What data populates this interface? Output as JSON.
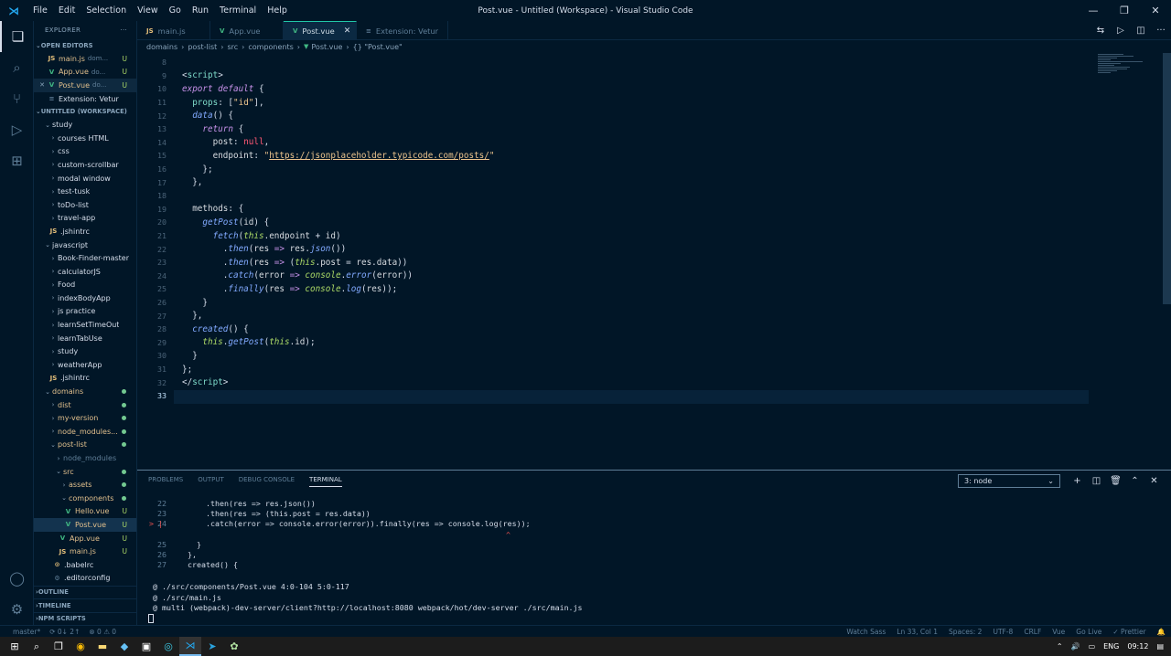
{
  "window": {
    "title": "Post.vue - Untitled (Workspace) - Visual Studio Code",
    "menu": [
      "File",
      "Edit",
      "Selection",
      "View",
      "Go",
      "Run",
      "Terminal",
      "Help"
    ]
  },
  "sidebar": {
    "header": "EXPLORER",
    "open_editors_label": "OPEN EDITORS",
    "open_editors": [
      {
        "icon": "JS",
        "name": "main.js",
        "desc": "dom...",
        "status": "U"
      },
      {
        "icon": "V",
        "name": "App.vue",
        "desc": "do...",
        "status": "U"
      },
      {
        "icon": "V",
        "name": "Post.vue",
        "desc": "do...",
        "status": "U"
      },
      {
        "icon": "≡",
        "name": "Extension: Vetur",
        "desc": "",
        "status": ""
      }
    ],
    "workspace_label": "UNTITLED (WORKSPACE)",
    "tree": [
      {
        "name": "study",
        "depth": 0
      },
      {
        "name": "courses HTML",
        "depth": 1
      },
      {
        "name": "css",
        "depth": 1
      },
      {
        "name": "custom-scrollbar",
        "depth": 1
      },
      {
        "name": "modal window",
        "depth": 1
      },
      {
        "name": "test-tusk",
        "depth": 1
      },
      {
        "name": "toDo-list",
        "depth": 1
      },
      {
        "name": "travel-app",
        "depth": 1
      },
      {
        "name": ".jshintrc",
        "depth": 1
      },
      {
        "name": "javascript",
        "depth": 0
      },
      {
        "name": "Book-Finder-master",
        "depth": 1
      },
      {
        "name": "calculatorJS",
        "depth": 1
      },
      {
        "name": "Food",
        "depth": 1
      },
      {
        "name": "indexBodyApp",
        "depth": 1
      },
      {
        "name": "js practice",
        "depth": 1
      },
      {
        "name": "learnSetTimeOut",
        "depth": 1
      },
      {
        "name": "learnTabUse",
        "depth": 1
      },
      {
        "name": "study",
        "depth": 1
      },
      {
        "name": "weatherApp",
        "depth": 1
      },
      {
        "name": ".jshintrc",
        "depth": 1
      },
      {
        "name": "domains",
        "depth": 0
      },
      {
        "name": "dist",
        "depth": 1
      },
      {
        "name": "my-version",
        "depth": 1
      },
      {
        "name": "node_modules...",
        "depth": 1
      },
      {
        "name": "post-list",
        "depth": 1
      },
      {
        "name": "node_modules",
        "depth": 2
      },
      {
        "name": "src",
        "depth": 2
      },
      {
        "name": "assets",
        "depth": 3
      },
      {
        "name": "components",
        "depth": 3
      },
      {
        "name": "Hello.vue",
        "depth": 4,
        "status": "U"
      },
      {
        "name": "Post.vue",
        "depth": 4,
        "status": "U"
      },
      {
        "name": "App.vue",
        "depth": 3,
        "status": "U"
      },
      {
        "name": "main.js",
        "depth": 3,
        "status": "U"
      },
      {
        "name": ".babelrc",
        "depth": 2
      },
      {
        "name": ".editorconfig",
        "depth": 2
      }
    ],
    "footer": [
      "OUTLINE",
      "TIMELINE",
      "NPM SCRIPTS"
    ]
  },
  "tabs": [
    {
      "icon": "JS",
      "label": "main.js"
    },
    {
      "icon": "V",
      "label": "App.vue"
    },
    {
      "icon": "V",
      "label": "Post.vue",
      "active": true
    },
    {
      "icon": "≡",
      "label": "Extension: Vetur"
    }
  ],
  "breadcrumb": [
    "domains",
    "post-list",
    "src",
    "components",
    "Post.vue",
    "{} \"Post.vue\""
  ],
  "editor": {
    "line_numbers": [
      "8",
      "9",
      "10",
      "11",
      "12",
      "13",
      "14",
      "15",
      "16",
      "17",
      "18",
      "19",
      "20",
      "21",
      "22",
      "23",
      "24",
      "25",
      "26",
      "27",
      "28",
      "29",
      "30",
      "31",
      "32",
      "33"
    ],
    "url": "https://jsonplaceholder.typicode.com/posts/"
  },
  "panel": {
    "tabs": [
      "PROBLEMS",
      "OUTPUT",
      "DEBUG CONSOLE",
      "TERMINAL"
    ],
    "terminal_select": "3: node",
    "error_lines": [
      {
        "n": "22",
        "text": "    .then(res => res.json())"
      },
      {
        "n": "23",
        "text": "    .then(res => (this.post = res.data))"
      },
      {
        "n": "24",
        "text": "    .catch(error => console.error(error)).finally(res => console.log(res));",
        "marker": "> |"
      },
      {
        "n": "",
        "text": ""
      },
      {
        "n": "25",
        "text": "  }"
      },
      {
        "n": "26",
        "text": "},"
      },
      {
        "n": "27",
        "text": "created() {"
      }
    ],
    "caret": "^",
    "output": [
      "@ ./src/components/Post.vue 4:0-104 5:0-117",
      "@ ./src/main.js",
      "@ multi (webpack)-dev-server/client?http://localhost:8080 webpack/hot/dev-server ./src/main.js"
    ]
  },
  "status": {
    "branch": "master*",
    "sync": "⟳ 0↓ 2↑",
    "problems": "⊗ 0 ⚠ 0",
    "watch": "Watch Sass",
    "position": "Ln 33, Col 1",
    "spaces": "Spaces: 2",
    "encoding": "UTF-8",
    "eol": "CRLF",
    "language": "Vue",
    "golive": "Go Live",
    "prettier": "✓ Prettier"
  },
  "taskbar": {
    "lang": "ENG",
    "time": "09:12"
  }
}
